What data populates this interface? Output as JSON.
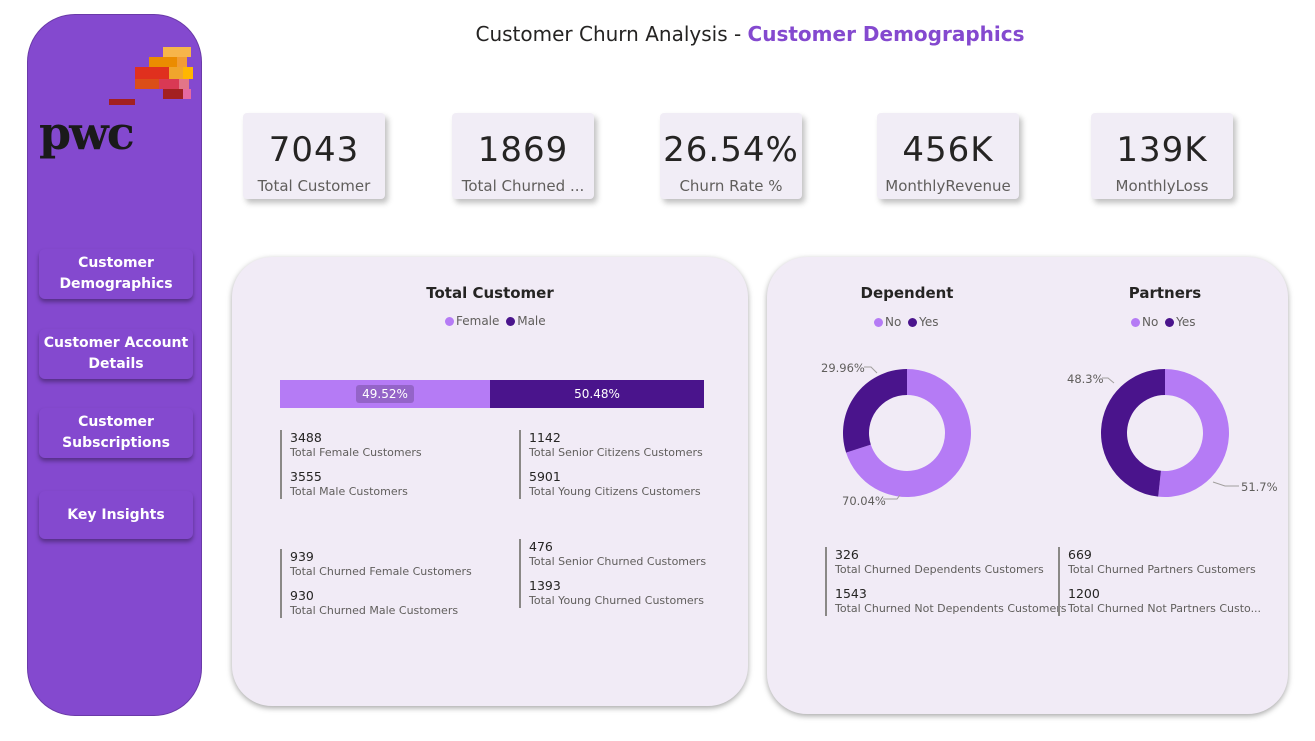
{
  "page": {
    "title_prefix": "Customer Churn Analysis - ",
    "title_accent": "Customer Demographics"
  },
  "logo": {
    "text": "pwc"
  },
  "sidebar": {
    "items": [
      {
        "label": "Customer Demographics"
      },
      {
        "label": "Customer Account Details"
      },
      {
        "label": "Customer Subscriptions"
      },
      {
        "label": "Key Insights"
      }
    ]
  },
  "kpis": [
    {
      "value": "7043",
      "label": "Total Customer"
    },
    {
      "value": "1869",
      "label": "Total Churned ..."
    },
    {
      "value": "26.54%",
      "label": "Churn Rate %"
    },
    {
      "value": "456K",
      "label": "MonthlyRevenue"
    },
    {
      "value": "139K",
      "label": "MonthlyLoss"
    }
  ],
  "total_customer": {
    "title": "Total Customer",
    "legend": [
      "Female",
      "Male"
    ],
    "female_pct": "49.52%",
    "male_pct": "50.48%",
    "stats": [
      {
        "value": "3488",
        "label": "Total Female Customers"
      },
      {
        "value": "3555",
        "label": "Total Male Customers"
      },
      {
        "value": "1142",
        "label": "Total Senior Citizens Customers"
      },
      {
        "value": "5901",
        "label": "Total Young Citizens Customers"
      },
      {
        "value": "939",
        "label": "Total Churned Female Customers"
      },
      {
        "value": "930",
        "label": "Total Churned Male Customers"
      },
      {
        "value": "476",
        "label": "Total Senior Churned Customers"
      },
      {
        "value": "1393",
        "label": "Total Young Churned Customers"
      }
    ]
  },
  "dependent": {
    "title": "Dependent",
    "legend": [
      "No",
      "Yes"
    ],
    "yes_label": "29.96%",
    "no_label": "70.04%",
    "stats": [
      {
        "value": "326",
        "label": "Total Churned Dependents Customers"
      },
      {
        "value": "1543",
        "label": "Total Churned Not Dependents Customers"
      }
    ]
  },
  "partners": {
    "title": "Partners",
    "legend": [
      "No",
      "Yes"
    ],
    "yes_label": "48.3%",
    "no_label": "51.7%",
    "stats": [
      {
        "value": "669",
        "label": "Total Churned Partners Customers"
      },
      {
        "value": "1200",
        "label": "Total Churned Not Partners Custo..."
      }
    ]
  },
  "chart_data": [
    {
      "type": "bar",
      "title": "Total Customer",
      "categories": [
        "Female",
        "Male"
      ],
      "values": [
        49.52,
        50.48
      ]
    },
    {
      "type": "pie",
      "title": "Dependent",
      "categories": [
        "No",
        "Yes"
      ],
      "values": [
        70.04,
        29.96
      ]
    },
    {
      "type": "pie",
      "title": "Partners",
      "categories": [
        "No",
        "Yes"
      ],
      "values": [
        51.7,
        48.3
      ]
    }
  ],
  "colors": {
    "light_purple": "#b57bf5",
    "dark_purple": "#4a148c",
    "sidebar": "#8449cf",
    "accent": "#8449cf"
  }
}
